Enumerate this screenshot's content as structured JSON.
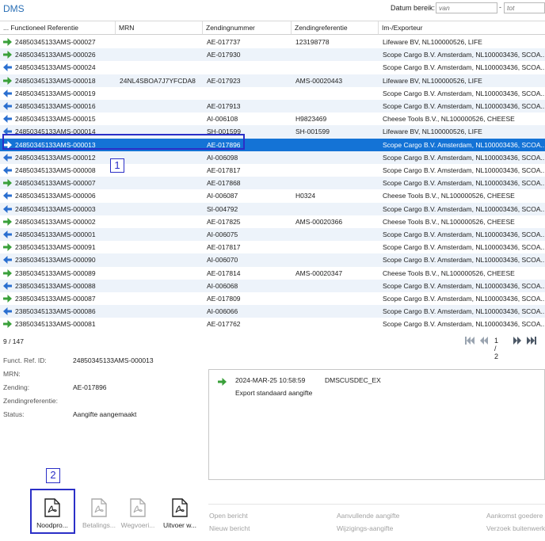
{
  "app": {
    "title": "DMS"
  },
  "date_range": {
    "label": "Datum bereik:",
    "from_placeholder": "van",
    "to_placeholder": "tot",
    "separator": "-"
  },
  "colors": {
    "accent": "#1473d6",
    "arrow_export": "#3aa03a",
    "arrow_import": "#2a6fd0",
    "annotation": "#2b2fc7"
  },
  "grid": {
    "columns": [
      {
        "label": "... Functioneel Referentie"
      },
      {
        "label": "MRN"
      },
      {
        "label": "Zendingnummer"
      },
      {
        "label": "Zendingreferentie"
      },
      {
        "label": "Im-/Exporteur"
      }
    ],
    "rows": [
      {
        "dir": "export",
        "ref": "24850345133AMS-000027",
        "mrn": "",
        "zending": "AE-017737",
        "zref": "123198778",
        "party": "Lifeware BV, NL100000526, LIFE"
      },
      {
        "dir": "export",
        "ref": "24850345133AMS-000026",
        "mrn": "",
        "zending": "AE-017930",
        "zref": "",
        "party": "Scope Cargo B.V. Amsterdam, NL100003436, SCOA..."
      },
      {
        "dir": "import",
        "ref": "24850345133AMS-000024",
        "mrn": "",
        "zending": "",
        "zref": "",
        "party": "Scope Cargo B.V. Amsterdam, NL100003436, SCOA..."
      },
      {
        "dir": "export",
        "ref": "24850345133AMS-000018",
        "mrn": "24NL4SBOA7J7YFCDA8",
        "zending": "AE-017923",
        "zref": "AMS-00020443",
        "party": "Lifeware BV, NL100000526, LIFE"
      },
      {
        "dir": "import",
        "ref": "24850345133AMS-000019",
        "mrn": "",
        "zending": "",
        "zref": "",
        "party": "Scope Cargo B.V. Amsterdam, NL100003436, SCOA..."
      },
      {
        "dir": "import",
        "ref": "24850345133AMS-000016",
        "mrn": "",
        "zending": "AE-017913",
        "zref": "",
        "party": "Scope Cargo B.V. Amsterdam, NL100003436, SCOA..."
      },
      {
        "dir": "import",
        "ref": "24850345133AMS-000015",
        "mrn": "",
        "zending": "AI-006108",
        "zref": "H9823469",
        "party": "Cheese Tools B.V., NL100000526, CHEESE"
      },
      {
        "dir": "import",
        "ref": "24850345133AMS-000014",
        "mrn": "",
        "zending": "SH-001599",
        "zref": "SH-001599",
        "party": "Lifeware BV, NL100000526, LIFE"
      },
      {
        "dir": "export",
        "ref": "24850345133AMS-000013",
        "mrn": "",
        "zending": "AE-017896",
        "zref": "",
        "party": "Scope Cargo B.V. Amsterdam, NL100003436, SCOA...",
        "selected": true
      },
      {
        "dir": "import",
        "ref": "24850345133AMS-000012",
        "mrn": "",
        "zending": "AI-006098",
        "zref": "",
        "party": "Scope Cargo B.V. Amsterdam, NL100003436, SCOA..."
      },
      {
        "dir": "import",
        "ref": "24850345133AMS-000008",
        "mrn": "",
        "zending": "AE-017817",
        "zref": "",
        "party": "Scope Cargo B.V. Amsterdam, NL100003436, SCOA..."
      },
      {
        "dir": "export",
        "ref": "24850345133AMS-000007",
        "mrn": "",
        "zending": "AE-017868",
        "zref": "",
        "party": "Scope Cargo B.V. Amsterdam, NL100003436, SCOA..."
      },
      {
        "dir": "import",
        "ref": "24850345133AMS-000006",
        "mrn": "",
        "zending": "AI-006087",
        "zref": "H0324",
        "party": "Cheese Tools B.V., NL100000526, CHEESE"
      },
      {
        "dir": "import",
        "ref": "24850345133AMS-000003",
        "mrn": "",
        "zending": "SI-004792",
        "zref": "",
        "party": "Scope Cargo B.V. Amsterdam, NL100003436, SCOA..."
      },
      {
        "dir": "export",
        "ref": "24850345133AMS-000002",
        "mrn": "",
        "zending": "AE-017825",
        "zref": "AMS-00020366",
        "party": "Cheese Tools B.V., NL100000526, CHEESE"
      },
      {
        "dir": "import",
        "ref": "24850345133AMS-000001",
        "mrn": "",
        "zending": "AI-006075",
        "zref": "",
        "party": "Scope Cargo B.V. Amsterdam, NL100003436, SCOA..."
      },
      {
        "dir": "export",
        "ref": "23850345133AMS-000091",
        "mrn": "",
        "zending": "AE-017817",
        "zref": "",
        "party": "Scope Cargo B.V. Amsterdam, NL100003436, SCOA..."
      },
      {
        "dir": "import",
        "ref": "23850345133AMS-000090",
        "mrn": "",
        "zending": "AI-006070",
        "zref": "",
        "party": "Scope Cargo B.V. Amsterdam, NL100003436, SCOA..."
      },
      {
        "dir": "export",
        "ref": "23850345133AMS-000089",
        "mrn": "",
        "zending": "AE-017814",
        "zref": "AMS-00020347",
        "party": "Cheese Tools B.V., NL100000526, CHEESE"
      },
      {
        "dir": "import",
        "ref": "23850345133AMS-000088",
        "mrn": "",
        "zending": "AI-006068",
        "zref": "",
        "party": "Scope Cargo B.V. Amsterdam, NL100003436, SCOA..."
      },
      {
        "dir": "export",
        "ref": "23850345133AMS-000087",
        "mrn": "",
        "zending": "AE-017809",
        "zref": "",
        "party": "Scope Cargo B.V. Amsterdam, NL100003436, SCOA..."
      },
      {
        "dir": "import",
        "ref": "23850345133AMS-000086",
        "mrn": "",
        "zending": "AI-006066",
        "zref": "",
        "party": "Scope Cargo B.V. Amsterdam, NL100003436, SCOA..."
      },
      {
        "dir": "export",
        "ref": "23850345133AMS-000081",
        "mrn": "",
        "zending": "AE-017762",
        "zref": "",
        "party": "Scope Cargo B.V. Amsterdam, NL100003436, SCOA..."
      }
    ]
  },
  "status_bar": {
    "count": "9 / 147",
    "page": "1 / 2"
  },
  "detail": {
    "fields": [
      {
        "label": "Funct. Ref. ID:",
        "value": "24850345133AMS-000013"
      },
      {
        "label": "MRN:",
        "value": ""
      },
      {
        "label": "Zending:",
        "value": "AE-017896"
      },
      {
        "label": "Zendingreferentie:",
        "value": ""
      },
      {
        "label": "Status:",
        "value": "Aangifte aangemaakt"
      }
    ]
  },
  "log": {
    "entry": {
      "timestamp": "2024-MAR-25 10:58:59",
      "code": "DMSCUSDEC_EX",
      "text": "Export standaard aangifte"
    }
  },
  "actions": {
    "open": "Open bericht",
    "new": "Nieuw bericht",
    "aanvullende": "Aanvullende aangifte",
    "wijzigings": "Wijzigings-aangifte",
    "aankomst": "Aankomst goedere",
    "verzoek": "Verzoek buitenwerk"
  },
  "toolbar": [
    {
      "label": "Noodpro...",
      "enabled": true
    },
    {
      "label": "Betalings...",
      "enabled": false
    },
    {
      "label": "Wegvoeri...",
      "enabled": false
    },
    {
      "label": "Uitvoer w...",
      "enabled": true
    }
  ],
  "annotations": {
    "badge1": "1",
    "badge2": "2"
  }
}
